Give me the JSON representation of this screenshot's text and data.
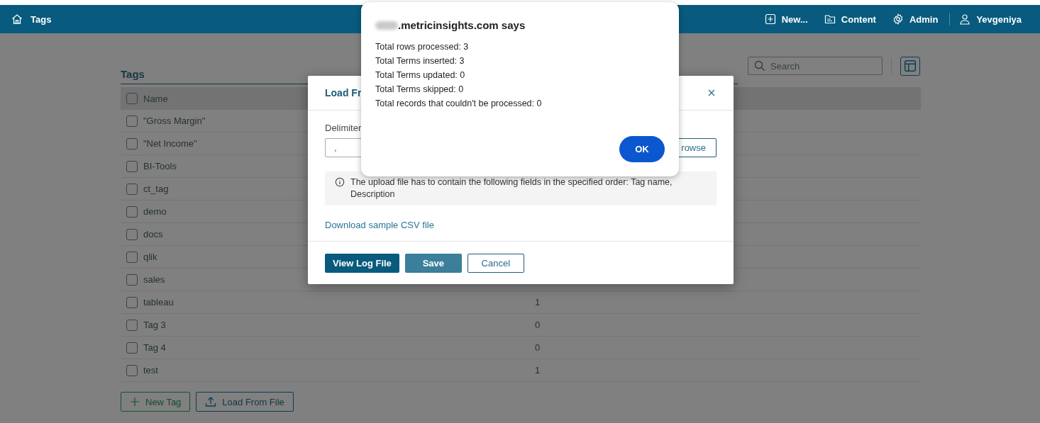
{
  "header": {
    "title": "Tags",
    "actions": [
      {
        "kind": "new",
        "label": "New..."
      },
      {
        "kind": "content",
        "label": "Content"
      },
      {
        "kind": "admin",
        "label": "Admin"
      },
      {
        "kind": "user",
        "label": "Yevgeniya"
      }
    ]
  },
  "page": {
    "title": "Tags",
    "search": {
      "placeholder": "Search"
    }
  },
  "table": {
    "columns": [
      "Name"
    ],
    "select_all_checked": false,
    "rows": [
      {
        "name": "\"Gross Margin\"",
        "checked": false
      },
      {
        "name": "\"Net Income\"",
        "checked": false
      },
      {
        "name": "BI-Tools",
        "checked": false
      },
      {
        "name": "ct_tag",
        "checked": false
      },
      {
        "name": "demo",
        "checked": false
      },
      {
        "name": "docs",
        "checked": false
      },
      {
        "name": "qlik",
        "checked": false
      },
      {
        "name": "sales",
        "checked": false
      },
      {
        "name": "tableau",
        "checked": false,
        "count": "1"
      },
      {
        "name": "Tag 3",
        "checked": false,
        "count": "0"
      },
      {
        "name": "Tag 4",
        "checked": false,
        "count": "0"
      },
      {
        "name": "test",
        "checked": false,
        "count": "1"
      }
    ]
  },
  "buttons": [
    {
      "kind": "add",
      "label": "New Tag"
    },
    {
      "kind": "upload",
      "label": "Load From File"
    }
  ],
  "dialog": {
    "title": "Load Fr",
    "delimiter_label": "Delimiter",
    "delimiter_value": ",",
    "browse": "rowse",
    "info": "The upload file has to contain the following fields in the specified order: Tag name, Description",
    "link": "Download sample CSV file",
    "buttons": [
      {
        "kind": "primary",
        "label": "View Log File"
      },
      {
        "kind": "secondary",
        "label": "Save"
      },
      {
        "kind": "outline",
        "label": "Cancel"
      }
    ]
  },
  "alert": {
    "title": ".metricinsights.com says",
    "lines": [
      "Total rows processed: 3",
      "Total Terms inserted: 3",
      "Total Terms updated: 0",
      "Total Terms skipped: 0",
      "Total records that couldn't be processed: 0"
    ],
    "ok": "OK"
  }
}
